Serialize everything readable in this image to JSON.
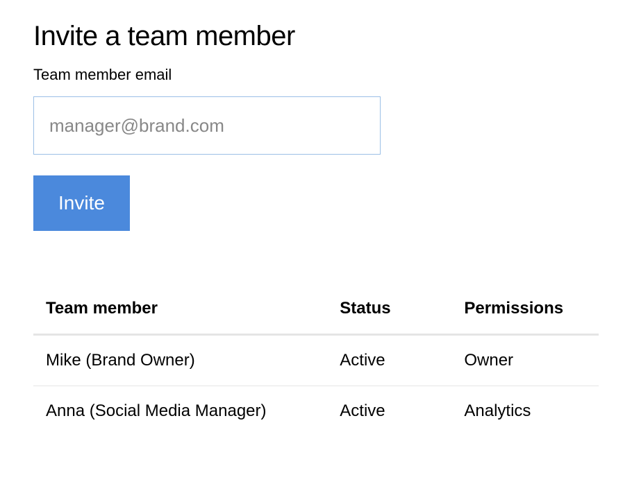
{
  "heading": "Invite a team member",
  "form": {
    "email_label": "Team member email",
    "email_placeholder": "manager@brand.com",
    "invite_button_label": "Invite"
  },
  "table": {
    "headers": {
      "member": "Team member",
      "status": "Status",
      "permissions": "Permissions"
    },
    "rows": [
      {
        "member": "Mike (Brand Owner)",
        "status": "Active",
        "permissions": "Owner"
      },
      {
        "member": "Anna (Social Media Manager)",
        "status": "Active",
        "permissions": "Analytics"
      }
    ]
  }
}
